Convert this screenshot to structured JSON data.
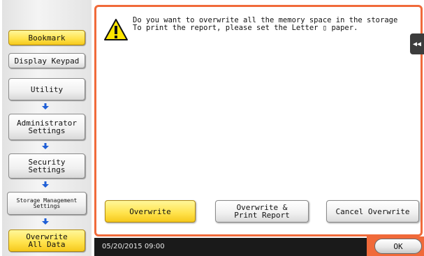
{
  "sidebar": {
    "bookmark_label": "Bookmark",
    "display_keypad_label": "Display Keypad",
    "breadcrumb": [
      {
        "label": "Utility"
      },
      {
        "label": "Administrator\nSettings"
      },
      {
        "label": "Security\nSettings"
      },
      {
        "label": "Storage Management\nSettings"
      },
      {
        "label": "Overwrite\nAll Data"
      }
    ]
  },
  "dialog": {
    "message": "Do you want to overwrite all the memory space in the storage\nTo print the report, please set the Letter ▯ paper.",
    "icon": "warning-icon"
  },
  "actions": {
    "overwrite_label": "Overwrite",
    "overwrite_print_label": "Overwrite &\nPrint Report",
    "cancel_label": "Cancel Overwrite"
  },
  "status": {
    "datetime": "05/20/2015  09:00",
    "ok_label": "OK"
  },
  "colors": {
    "accent_orange": "#f06a3a",
    "highlight_yellow": "#ffe24a",
    "arrow_blue": "#1f5fd6"
  }
}
